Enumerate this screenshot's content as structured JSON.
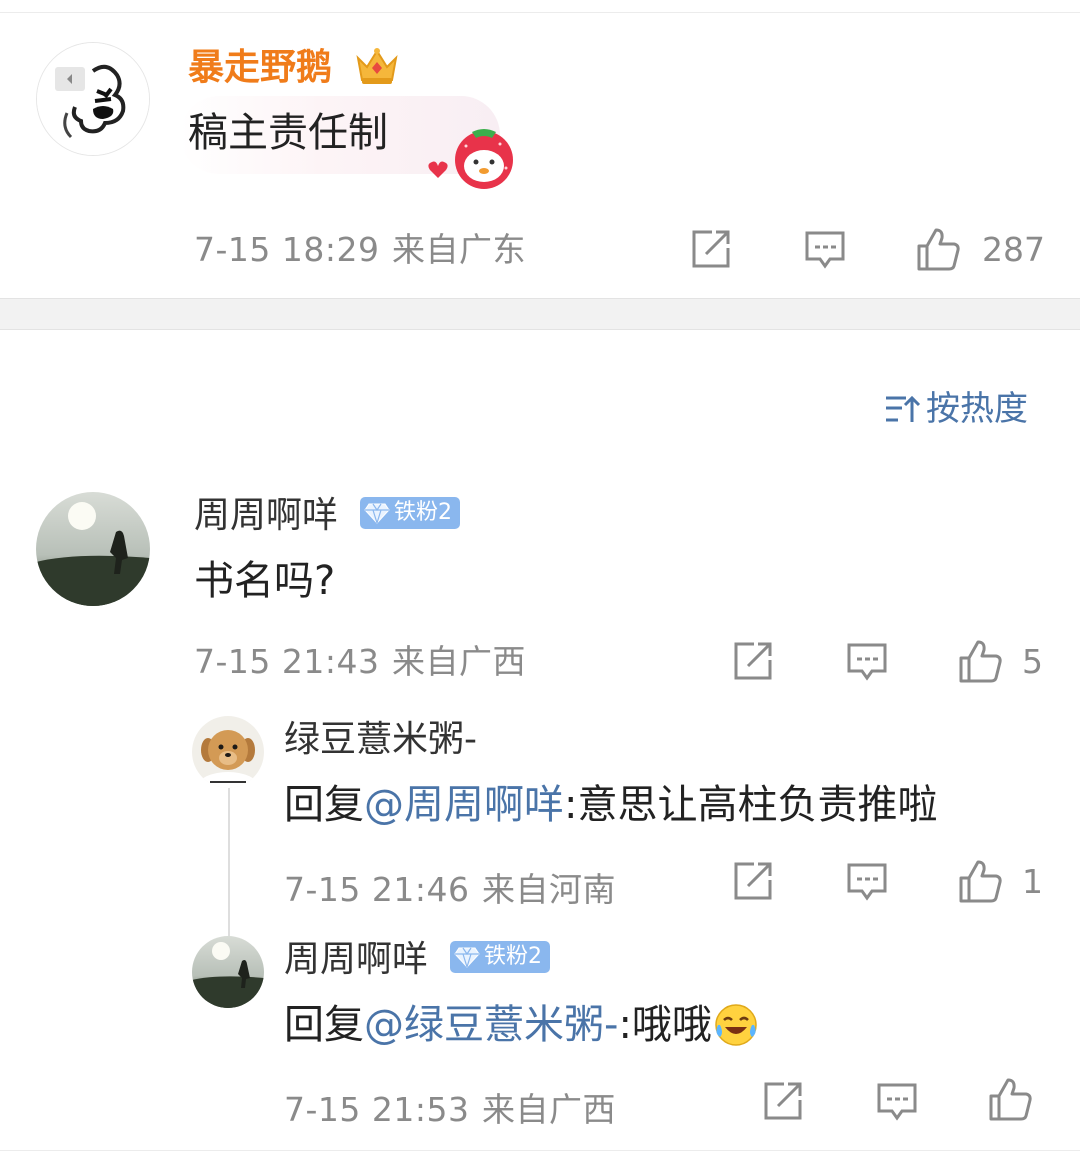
{
  "top_comment": {
    "username": "暴走野鹅",
    "text": "稿主责任制",
    "time": "7-15 18:29",
    "location": "来自广东",
    "likes": "287",
    "icons": [
      "crown-icon",
      "strawberry-sticker-icon",
      "share-icon",
      "comment-icon",
      "like-icon"
    ]
  },
  "sort": {
    "label": "按热度",
    "icon": "sort-icon"
  },
  "comments": [
    {
      "username": "周周啊咩",
      "badge": "铁粉2",
      "text": "书名吗?",
      "time": "7-15 21:43",
      "location": "来自广西",
      "likes": "5",
      "replies": [
        {
          "username": "绿豆薏米粥-",
          "reply_prefix": "回复",
          "mention": "@周周啊咩",
          "text": ":意思让高柱负责推啦",
          "time": "7-15 21:46",
          "location": "来自河南",
          "likes": "1"
        },
        {
          "username": "周周啊咩",
          "badge": "铁粉2",
          "reply_prefix": "回复",
          "mention": "@绿豆薏米粥-",
          "text": ":哦哦",
          "emoji": "laughing-crying-emoji",
          "time": "7-15 21:53",
          "location": "来自广西",
          "likes": ""
        }
      ]
    }
  ],
  "colors": {
    "vip_name": "#f07c1a",
    "mention": "#4a74a8",
    "meta": "#8a8a8a",
    "badge": "#8ab7ee",
    "divider": "#f2f2f2"
  }
}
